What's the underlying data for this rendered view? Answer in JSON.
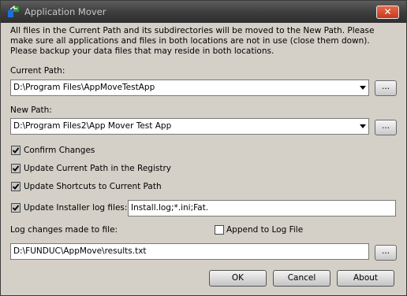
{
  "window": {
    "title": "Application Mover"
  },
  "description": "All files in the Current Path and its subdirectories will be moved to the New Path.  Please make sure all applications and files in both locations are not in use (close them down).  Please backup your data files that may reside in both locations.",
  "current_path": {
    "label": "Current Path:",
    "value": "D:\\Program Files\\AppMoveTestApp",
    "browse_label": "..."
  },
  "new_path": {
    "label": "New Path:",
    "value": "D:\\Program Files2\\App Mover Test App",
    "browse_label": "..."
  },
  "options": {
    "confirm_changes": {
      "label": "Confirm Changes",
      "checked": true
    },
    "update_registry": {
      "label": "Update Current Path in the Registry",
      "checked": true
    },
    "update_shortcuts": {
      "label": "Update Shortcuts to Current Path",
      "checked": true
    },
    "update_installer_logs": {
      "label": "Update Installer log files:",
      "checked": true,
      "value": "Install.log;*.ini;Fat."
    }
  },
  "log": {
    "label": "Log changes made to file:",
    "append_label": "Append to Log File",
    "append_checked": false,
    "value": "D:\\FUNDUC\\AppMove\\results.txt",
    "browse_label": "..."
  },
  "buttons": {
    "ok": "OK",
    "cancel": "Cancel",
    "about": "About"
  },
  "icons": {
    "close": "close-icon",
    "app": "app-icon",
    "dropdown": "chevron-down-icon",
    "check": "checkmark-icon"
  },
  "colors": {
    "titlebar": "#3c3c3c",
    "dialog_bg": "#d4d0c8",
    "close_button": "#d84a2c"
  }
}
